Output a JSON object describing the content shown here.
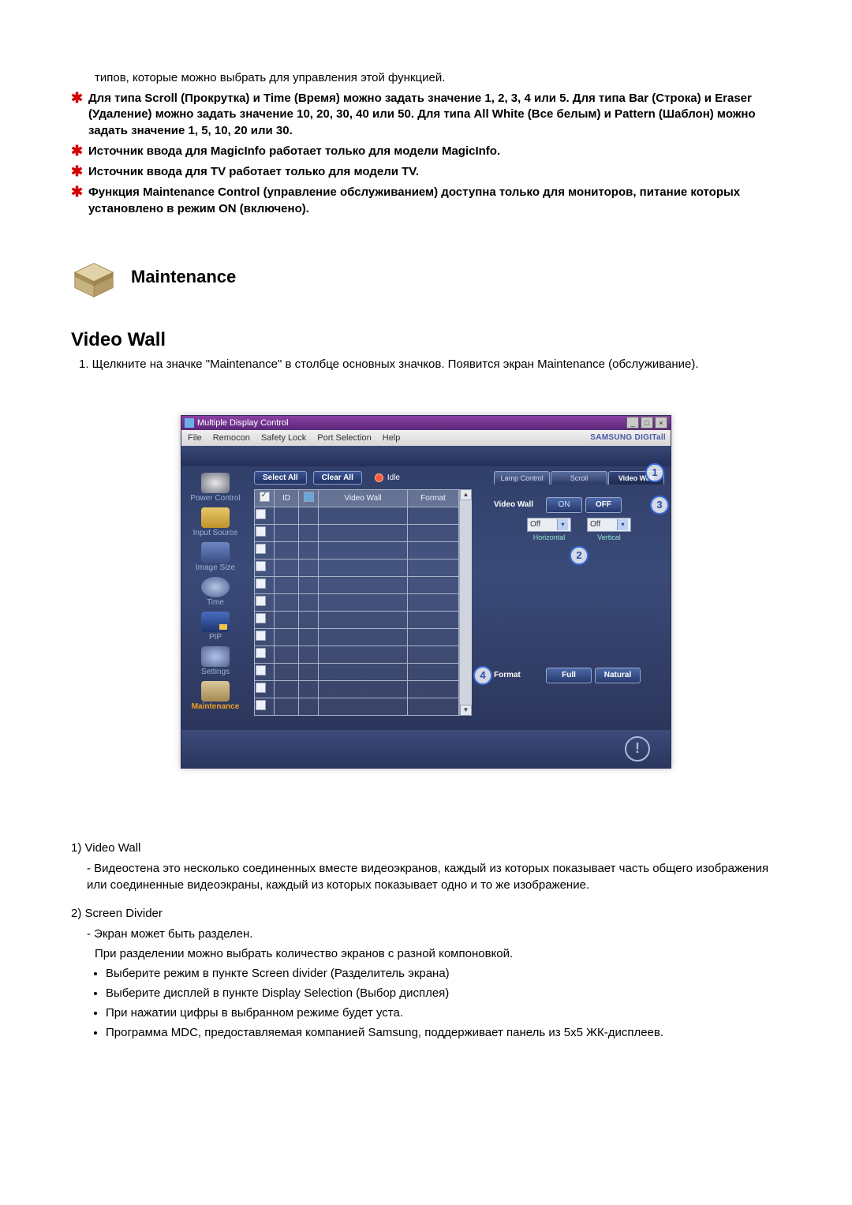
{
  "intro": "типов, которые можно выбрать для управления этой функцией.",
  "stars": [
    "Для типа Scroll (Прокрутка) и Time (Время) можно задать значение 1, 2, 3, 4 или 5. Для типа Bar (Строка) и Eraser (Удаление) можно задать значение 10, 20, 30, 40 или 50. Для типа All White (Все белым) и Pattern (Шаблон) можно задать значение 1, 5, 10, 20 или 30.",
    "Источник ввода для MagicInfo работает только для модели MagicInfo.",
    "Источник ввода для TV работает только для модели TV.",
    "Функция Maintenance Control (управление обслуживанием) доступна только для мониторов, питание которых установлено в режим ON (включено)."
  ],
  "maintenance_title": "Maintenance",
  "video_wall_title": "Video Wall",
  "step1": "1.  Щелкните на значке \"Maintenance\" в столбце основных значков. Появится экран Maintenance (обслуживание).",
  "app": {
    "title": "Multiple Display Control",
    "menus": [
      "File",
      "Remocon",
      "Safety Lock",
      "Port Selection",
      "Help"
    ],
    "brand": "SAMSUNG DIGITall",
    "sidebar": [
      "Power Control",
      "Input Source",
      "Image Size",
      "Time",
      "PIP",
      "Settings",
      "Maintenance"
    ],
    "buttons": {
      "select_all": "Select All",
      "clear_all": "Clear All",
      "idle": "Idle"
    },
    "grid": {
      "cols": [
        "",
        "ID",
        "",
        "Video Wall",
        "Format"
      ],
      "rows": 12
    },
    "tabs": [
      "Lamp Control",
      "Scroll",
      "Video Wall"
    ],
    "panel": {
      "video_wall_label": "Video Wall",
      "on": "ON",
      "off": "OFF",
      "horiz_val": "Off",
      "vert_val": "Off",
      "horiz_lbl": "Horizontal",
      "vert_lbl": "Vertical",
      "format_label": "Format",
      "full": "Full",
      "natural": "Natural"
    },
    "callouts": {
      "c1": "1",
      "c2": "2",
      "c3": "3",
      "c4": "4"
    }
  },
  "desc": {
    "l1": "1) Video Wall",
    "l1a": "- Видеостена это несколько соединенных вместе видеоэкранов, каждый из которых показывает часть общего изображения или соединенные видеоэкраны, каждый из которых показывает одно и то же изображение.",
    "l2": "2) Screen Divider",
    "l2a": "- Экран может быть разделен.",
    "l2b": "При разделении можно выбрать количество экранов с разной компоновкой.",
    "bullets": [
      "Выберите режим в пункте Screen divider (Разделитель экрана)",
      "Выберите дисплей в пункте Display Selection (Выбор дисплея)",
      "При нажатии цифры в выбранном режиме будет уста.",
      "Программа MDC, предоставляемая компанией Samsung, поддерживает панель из 5x5 ЖК-дисплеев."
    ]
  }
}
